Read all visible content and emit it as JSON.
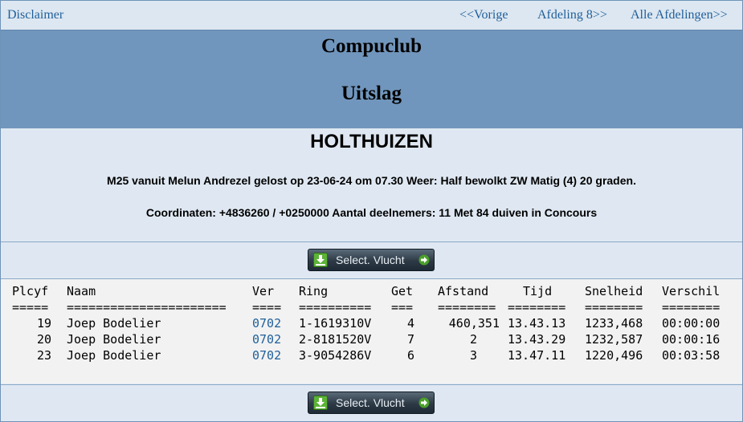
{
  "nav": {
    "disclaimer": "Disclaimer",
    "prev": "<<Vorige",
    "next": "Afdeling 8>>",
    "all": "Alle Afdelingen>>"
  },
  "header": {
    "title": "Compuclub",
    "subtitle": "Uitslag"
  },
  "info": {
    "place": "HOLTHUIZEN",
    "line1": "M25 vanuit Melun Andrezel gelost op 23-06-24 om 07.30 Weer: Half bewolkt ZW Matig (4) 20 graden.",
    "line2": "Coordinaten: +4836260 / +0250000 Aantal deelnemers: 11 Met 84 duiven in Concours"
  },
  "select_button": {
    "label": "Select. Vlucht"
  },
  "table": {
    "headers": {
      "plcyf": "Plcyf",
      "naam": "Naam",
      "ver": "Ver",
      "ring": "Ring",
      "get": "Get",
      "afstand": "Afstand",
      "tijd": "Tijd",
      "snelheid": "Snelheid",
      "verschil": "Verschil"
    },
    "separators": {
      "plcyf": "=====",
      "naam": "======================",
      "ver": "====",
      "ring": "==========",
      "get": "===",
      "afstand": "========",
      "tijd": "========",
      "snelheid": "========",
      "verschil": "========"
    },
    "rows": [
      {
        "plcyf": "19",
        "naam": "Joep Bodelier",
        "ver": "0702",
        "ring": "1-1619310V",
        "get": "4",
        "afstand": "460,351",
        "tijd": "13.43.13",
        "snelheid": "1233,468",
        "verschil": "00:00:00"
      },
      {
        "plcyf": "20",
        "naam": "Joep Bodelier",
        "ver": "0702",
        "ring": "2-8181520V",
        "get": "7",
        "afstand": "2",
        "tijd": "13.43.29",
        "snelheid": "1232,587",
        "verschil": "00:00:16"
      },
      {
        "plcyf": "23",
        "naam": "Joep Bodelier",
        "ver": "0702",
        "ring": "3-9054286V",
        "get": "6",
        "afstand": "3",
        "tijd": "13.47.11",
        "snelheid": "1220,496",
        "verschil": "00:03:58"
      }
    ]
  }
}
